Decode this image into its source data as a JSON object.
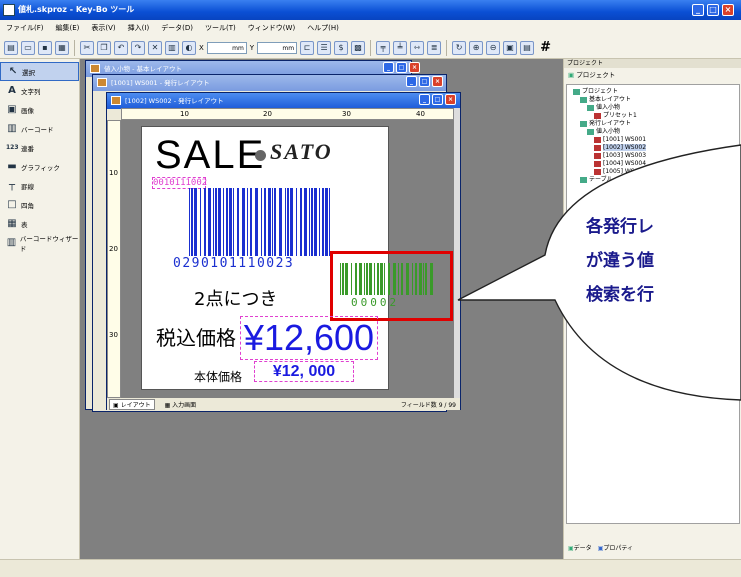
{
  "app": {
    "title": "値札.skproz - Key-Bo ツール"
  },
  "menu": [
    "ファイル(F)",
    "編集(E)",
    "表示(V)",
    "挿入(I)",
    "データ(D)",
    "ツール(T)",
    "ウィンドウ(W)",
    "ヘルプ(H)"
  ],
  "toolbar": {
    "x_label": "X",
    "x_unit": "mm",
    "y_label": "Y",
    "y_unit": "mm",
    "grid_glyph": "#"
  },
  "toolbox": {
    "items": [
      {
        "label": "選択",
        "icon": "pointer-icon",
        "glyph": "↖"
      },
      {
        "label": "文字列",
        "icon": "text-icon",
        "glyph": "A"
      },
      {
        "label": "画像",
        "icon": "image-icon",
        "glyph": "▣"
      },
      {
        "label": "バーコード",
        "icon": "barcode-icon",
        "glyph": "▥"
      },
      {
        "label": "連番",
        "icon": "serial-icon",
        "glyph": "123"
      },
      {
        "label": "グラフィック",
        "icon": "graphic-icon",
        "glyph": "▬"
      },
      {
        "label": "罫線",
        "icon": "line-icon",
        "glyph": "┬"
      },
      {
        "label": "四角",
        "icon": "rect-icon",
        "glyph": "□"
      },
      {
        "label": "表",
        "icon": "table-icon",
        "glyph": "▦"
      },
      {
        "label": "バーコードウィザード",
        "icon": "barcode-wizard-icon",
        "glyph": "▥"
      }
    ]
  },
  "windows": {
    "w1": {
      "title": "値入小物 - 基本レイアウト"
    },
    "w2": {
      "title": "[1001] WS001 - 発行レイアウト"
    },
    "w3": {
      "title": "[1002] WS002 - 発行レイアウト"
    }
  },
  "ruler_marks": [
    "10",
    "20",
    "30",
    "40"
  ],
  "ruler_marks_v": [
    "10",
    "20",
    "30"
  ],
  "label": {
    "sale": "SALE",
    "brand": "SATO",
    "code_top": "0010111002",
    "barcode_digits": "0290101110023",
    "small_barcode_digits": "00002",
    "per_two": "2点につき",
    "tax_label": "税込価格",
    "price": "¥12,600",
    "base_label": "本体価格",
    "base_price": "¥12, 000"
  },
  "bottom_tabs": {
    "layout": "レイアウト",
    "input": "入力画面",
    "field_count": "フィールド数 9 / 99"
  },
  "project": {
    "panel_title": "プロジェクト",
    "header": "プロジェクト",
    "tree": [
      {
        "text": "プロジェクト",
        "depth": 0
      },
      {
        "text": "基本レイアウト",
        "depth": 1
      },
      {
        "text": "値入小物",
        "depth": 2
      },
      {
        "text": "プリセット1",
        "depth": 3
      },
      {
        "text": "発行レイアウト",
        "depth": 1
      },
      {
        "text": "値入小物",
        "depth": 2
      },
      {
        "text": "[1001] WS001",
        "depth": 3
      },
      {
        "text": "[1002] WS002",
        "depth": 3
      },
      {
        "text": "[1003] WS003",
        "depth": 3
      },
      {
        "text": "[1004] WS004",
        "depth": 3
      },
      {
        "text": "[1005] WS005",
        "depth": 3
      },
      {
        "text": "テーブル",
        "depth": 1
      }
    ],
    "tab_data": "データ",
    "tab_property": "プロパティ"
  },
  "callout": {
    "lines": [
      "各発行レ",
      "が違う値",
      "検索を行"
    ]
  },
  "colors": {
    "callout_text": "#1a1a8c",
    "highlight_border": "#e00000",
    "blue_barcode": "#1a2fd0",
    "green_barcode": "#3a9a2a",
    "magenta_box": "#e040d0"
  }
}
